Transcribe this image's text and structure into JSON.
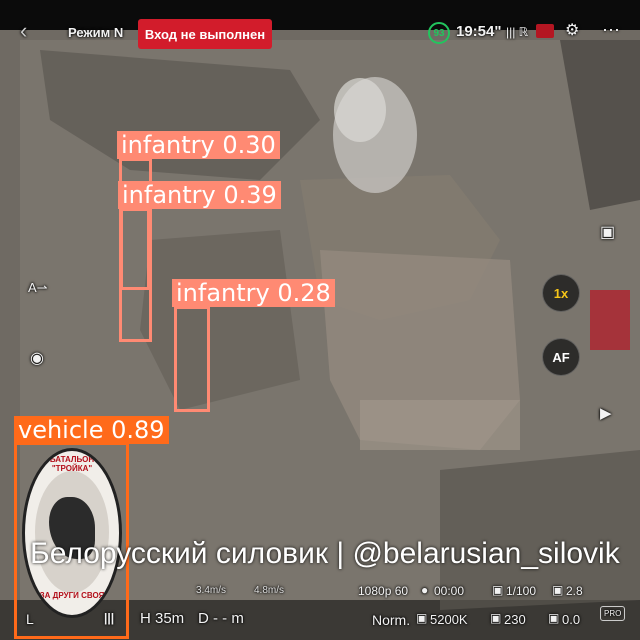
{
  "topbar": {
    "mode_label": "Режим N",
    "login_badge": "Вход не выполнен",
    "battery_level": "93",
    "time": "19:54\"",
    "signal_text": "||| ℝ",
    "accent_green": "#22c55e",
    "alert_red": "#e11d2e"
  },
  "camera": {
    "zoom_label": "1x",
    "af_label": "AF"
  },
  "detections": [
    {
      "label": "infantry 0.30",
      "color": "#ff8a73"
    },
    {
      "label": "infantry 0.39",
      "color": "#ff8a73"
    },
    {
      "label": "infantry 0.28",
      "color": "#ff8a73"
    },
    {
      "label": "vehicle 0.89",
      "color": "#ff6a1a"
    }
  ],
  "watermark": {
    "caption": "Белорусский силовик | @belarusian_silovik",
    "emblem_top": "БАТАЛЬОН \"ТРОЙКА\"",
    "emblem_bottom": "ЗА ДРУГИ СВОЯ"
  },
  "telemetry": {
    "hspeed": "3.4m/s",
    "vspeed": "4.8m/s",
    "height": "H 35m",
    "distance": "D - - m",
    "video_mode": "1080p 60",
    "rec_time": "00:00",
    "shutter": "1/100",
    "aperture": "2.8",
    "color_mode": "Norm.",
    "white_balance": "5200K",
    "iso": "230",
    "ev": "0.0",
    "left_hud": "L",
    "bars": "|||",
    "pro_label": "PRO"
  }
}
